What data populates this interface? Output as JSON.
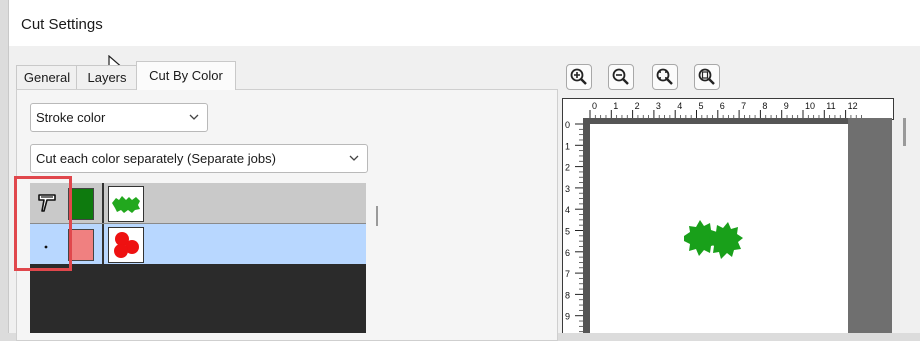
{
  "window": {
    "title": "Cut Settings"
  },
  "tabs": [
    {
      "label": "General"
    },
    {
      "label": "Layers"
    },
    {
      "label": "Cut By Color"
    }
  ],
  "filters": {
    "color_type": "Stroke color",
    "cut_mode": "Cut each color separately (Separate jobs)"
  },
  "color_rows": [
    {
      "icon": "pen-tool-icon",
      "swatch": "#0e7a0e",
      "thumb": "green-holly-icon"
    },
    {
      "icon": "dot-icon",
      "swatch": "#f08080",
      "thumb": "red-berries-icon"
    }
  ],
  "zoom_tools": [
    "zoom-in-icon",
    "zoom-out-icon",
    "zoom-fit-icon",
    "zoom-page-icon"
  ],
  "ruler": {
    "x_ticks": [
      "0",
      "1",
      "2",
      "3",
      "4",
      "5",
      "6",
      "7",
      "8",
      "9",
      "10",
      "11",
      "12"
    ],
    "y_ticks": [
      "0",
      "1",
      "2",
      "3",
      "4",
      "5",
      "6",
      "7",
      "8",
      "9"
    ]
  },
  "colors": {
    "highlight": "#e0474c",
    "selected_row": "#b8d7ff",
    "canvas_bg": "#555555"
  }
}
